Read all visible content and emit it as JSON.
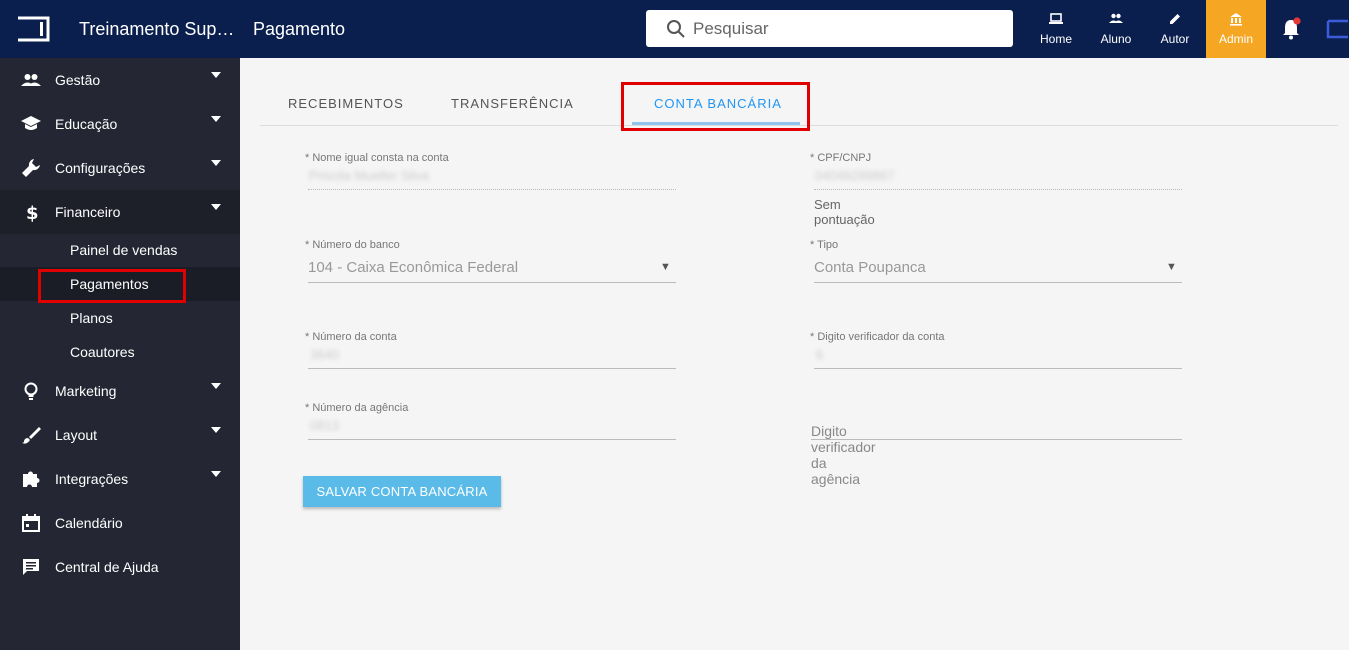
{
  "header": {
    "app_title": "Treinamento Suporte",
    "page_title": "Pagamento",
    "search_placeholder": "Pesquisar",
    "nav": [
      {
        "label": "Home",
        "icon": "laptop-icon"
      },
      {
        "label": "Aluno",
        "icon": "users-icon"
      },
      {
        "label": "Autor",
        "icon": "pencil-icon"
      },
      {
        "label": "Admin",
        "icon": "bank-icon"
      }
    ],
    "admin_color": "#f5a623",
    "bar_color": "#0a1f4e"
  },
  "sidebar": {
    "items": [
      {
        "label": "Gestão",
        "icon": "group-icon"
      },
      {
        "label": "Educação",
        "icon": "graduation-cap-icon"
      },
      {
        "label": "Configurações",
        "icon": "wrench-icon"
      },
      {
        "label": "Financeiro",
        "icon": "dollar-icon"
      },
      {
        "label": "Marketing",
        "icon": "lightbulb-icon"
      },
      {
        "label": "Layout",
        "icon": "brush-icon"
      },
      {
        "label": "Integrações",
        "icon": "puzzle-icon"
      },
      {
        "label": "Calendário",
        "icon": "calendar-icon"
      },
      {
        "label": "Central de Ajuda",
        "icon": "chat-icon"
      }
    ],
    "financeiro_sub": [
      {
        "label": "Painel de vendas"
      },
      {
        "label": "Pagamentos"
      },
      {
        "label": "Planos"
      },
      {
        "label": "Coautores"
      }
    ]
  },
  "tabs": [
    {
      "label": "RECEBIMENTOS"
    },
    {
      "label": "TRANSFERÊNCIA"
    },
    {
      "label": "CONTA BANCÁRIA"
    }
  ],
  "form": {
    "nome": {
      "label": "* Nome igual consta na conta",
      "value": "Priscila Mueller Silva"
    },
    "cpf": {
      "label": "* CPF/CNPJ",
      "value": "04049289867",
      "hint": "Sem pontuação"
    },
    "banco": {
      "label": "* Número do banco",
      "value": "104 - Caixa Econômica Federal"
    },
    "tipo": {
      "label": "* Tipo",
      "value": "Conta Poupanca"
    },
    "conta": {
      "label": "* Número da conta",
      "value": "3640"
    },
    "digito_conta": {
      "label": "* Digito verificador da conta",
      "value": "6"
    },
    "agencia": {
      "label": "* Número da agência",
      "value": "0813"
    },
    "digito_agencia": {
      "label": "Digito verificador da agência"
    },
    "save_label": "SALVAR CONTA BANCÁRIA"
  }
}
